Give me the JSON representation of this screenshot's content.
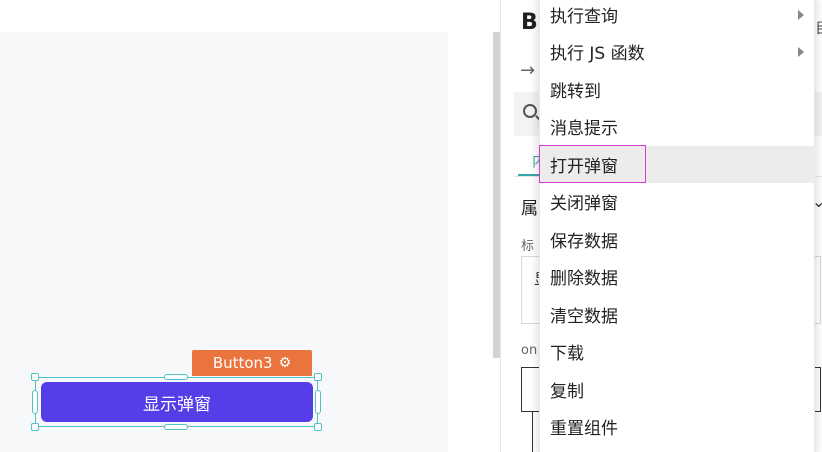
{
  "canvas": {
    "widget_tag_label": "Button3",
    "widget_tag_icon": "gear-icon",
    "button_label": "显示弹窗",
    "button_color": "#553de8",
    "tag_color": "#e9743e",
    "selection_color": "#4fc3c3"
  },
  "panel": {
    "title": "Bu",
    "tab_partial": "内",
    "section_partial": "属",
    "label1_partial": "标",
    "field1_partial": "显",
    "label2_partial": "on",
    "edge_glyph": "㠯"
  },
  "menu": {
    "items": [
      {
        "label": "执行查询",
        "has_submenu": true
      },
      {
        "label": "执行 JS 函数",
        "has_submenu": true
      },
      {
        "label": "跳转到",
        "has_submenu": false
      },
      {
        "label": "消息提示",
        "has_submenu": false
      },
      {
        "label": "打开弹窗",
        "has_submenu": false,
        "highlighted": true
      },
      {
        "label": "关闭弹窗",
        "has_submenu": false
      },
      {
        "label": "保存数据",
        "has_submenu": false
      },
      {
        "label": "删除数据",
        "has_submenu": false
      },
      {
        "label": "清空数据",
        "has_submenu": false
      },
      {
        "label": "下载",
        "has_submenu": false
      },
      {
        "label": "复制",
        "has_submenu": false
      },
      {
        "label": "重置组件",
        "has_submenu": false
      }
    ]
  }
}
